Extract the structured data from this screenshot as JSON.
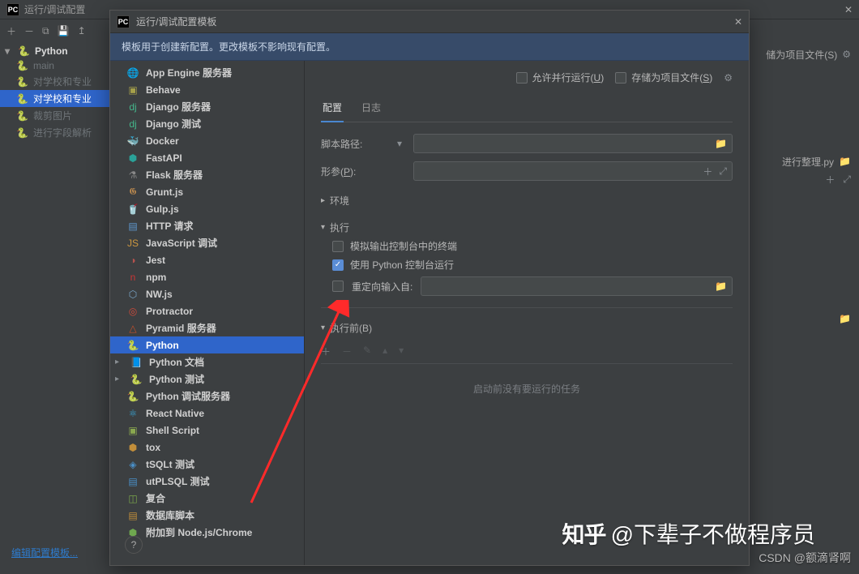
{
  "parent": {
    "title": "运行/调试配置",
    "close": "✕",
    "edit_template": "编辑配置模板...",
    "store_as_project": "储为项目文件",
    "store_key": "S",
    "file_suffix": "进行整理.py",
    "tree": {
      "root": "Python",
      "items": [
        "main",
        "对学校和专业",
        "对学校和专业",
        "裁剪图片",
        "进行字段解析"
      ]
    }
  },
  "modal": {
    "title": "运行/调试配置模板",
    "banner": "模板用于创建新配置。更改模板不影响现有配置。",
    "list": [
      {
        "label": "App Engine 服务器",
        "ico": "🌐",
        "c": "#3d88d6"
      },
      {
        "label": "Behave",
        "ico": "▣",
        "c": "#a6a04a"
      },
      {
        "label": "Django 服务器",
        "ico": "dj",
        "c": "#44b78b"
      },
      {
        "label": "Django 测试",
        "ico": "dj",
        "c": "#44b78b"
      },
      {
        "label": "Docker",
        "ico": "🐳",
        "c": "#4aa6d6"
      },
      {
        "label": "FastAPI",
        "ico": "⬢",
        "c": "#2aa198"
      },
      {
        "label": "Flask 服务器",
        "ico": "⚗",
        "c": "#888"
      },
      {
        "label": "Grunt.js",
        "ico": "𝕲",
        "c": "#c58f4f"
      },
      {
        "label": "Gulp.js",
        "ico": "🥤",
        "c": "#d64a4a"
      },
      {
        "label": "HTTP 请求",
        "ico": "▤",
        "c": "#5f99d1"
      },
      {
        "label": "JavaScript 调试",
        "ico": "JS",
        "c": "#ce9840"
      },
      {
        "label": "Jest",
        "ico": "◑",
        "c": "#b5524e"
      },
      {
        "label": "npm",
        "ico": "n",
        "c": "#cc3534"
      },
      {
        "label": "NW.js",
        "ico": "⬡",
        "c": "#7aa6c9"
      },
      {
        "label": "Protractor",
        "ico": "◎",
        "c": "#d24a3a"
      },
      {
        "label": "Pyramid 服务器",
        "ico": "△",
        "c": "#c5502a"
      },
      {
        "label": "Python",
        "ico": "🐍",
        "c": "#3b78c6",
        "sel": true
      },
      {
        "label": "Python 文档",
        "ico": "📘",
        "c": "#3b78c6",
        "chev": true
      },
      {
        "label": "Python 测试",
        "ico": "🐍",
        "c": "#3b78c6",
        "chev": true
      },
      {
        "label": "Python 调试服务器",
        "ico": "🐍",
        "c": "#3b78c6"
      },
      {
        "label": "React Native",
        "ico": "⚛",
        "c": "#3aa6d6"
      },
      {
        "label": "Shell Script",
        "ico": "▣",
        "c": "#8aa84f"
      },
      {
        "label": "tox",
        "ico": "⬢",
        "c": "#c28e3a"
      },
      {
        "label": "tSQLt 测试",
        "ico": "◈",
        "c": "#4a90c9"
      },
      {
        "label": "utPLSQL 测试",
        "ico": "▤",
        "c": "#4a90c9"
      },
      {
        "label": "复合",
        "ico": "◫",
        "c": "#7aa64a"
      },
      {
        "label": "数据库脚本",
        "ico": "▤",
        "c": "#c28e3a"
      },
      {
        "label": "附加到 Node.js/Chrome",
        "ico": "⬢",
        "c": "#6fa84f"
      }
    ],
    "head": {
      "allow_parallel": "允许并行运行",
      "allow_key": "U",
      "store_project": "存储为项目文件",
      "store_key": "S"
    },
    "tabs": {
      "config": "配置",
      "log": "日志"
    },
    "form": {
      "script_path": "脚本路径:",
      "params": "形参",
      "params_key": "P",
      "env": "环境",
      "execute": "执行",
      "emulate": "模拟输出控制台中的终端",
      "pyconsole": "使用 Python 控制台运行",
      "redirect": "重定向输入自:",
      "before": "执行前",
      "before_key": "B",
      "empty": "启动前没有要运行的任务"
    }
  },
  "watermark1_a": "知乎",
  "watermark1_b": "@下辈子不做程序员",
  "watermark2": "CSDN @额滴肾啊"
}
